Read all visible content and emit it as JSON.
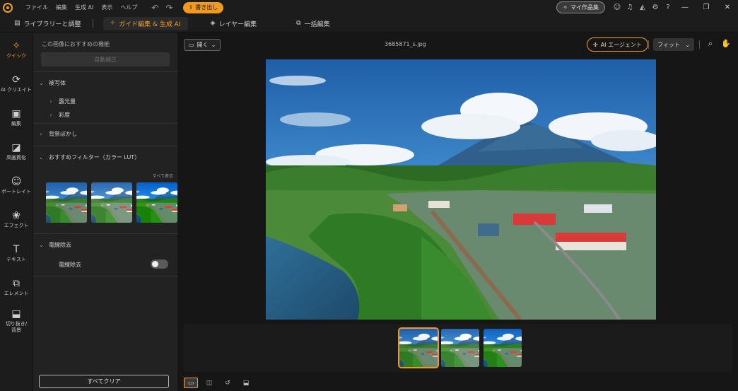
{
  "titlebar": {
    "menu": [
      "ファイル",
      "編集",
      "生成 AI",
      "表示",
      "ヘルプ"
    ],
    "export_label": "書き出し",
    "myworks_label": "マイ作品集"
  },
  "tabs": [
    {
      "label": "ライブラリーと調整",
      "active": false
    },
    {
      "label": "ガイド編集 & 生成 AI",
      "active": true
    },
    {
      "label": "レイヤー編集",
      "active": false
    },
    {
      "label": "一括編集",
      "active": false
    }
  ],
  "rail": [
    {
      "label": "クイック",
      "icon": "magic-wand-icon",
      "glyph": "✧",
      "active": true
    },
    {
      "label": "AI クリエイト",
      "icon": "ai-create-icon",
      "glyph": "⟳",
      "active": false
    },
    {
      "label": "編集",
      "icon": "edit-image-icon",
      "glyph": "▣",
      "active": false
    },
    {
      "label": "高画質化",
      "icon": "enhance-icon",
      "glyph": "◪",
      "active": false
    },
    {
      "label": "ポートレイト",
      "icon": "portrait-icon",
      "glyph": "☺",
      "active": false
    },
    {
      "label": "エフェクト",
      "icon": "effects-icon",
      "glyph": "❀",
      "active": false
    },
    {
      "label": "テキスト",
      "icon": "text-icon",
      "glyph": "T",
      "active": false
    },
    {
      "label": "エレメント",
      "icon": "elements-icon",
      "glyph": "⧉",
      "active": false
    },
    {
      "label": "切り抜き/\n背景",
      "icon": "cutout-icon",
      "glyph": "⬓",
      "active": false
    }
  ],
  "panel": {
    "heading": "この画像におすすめの機能",
    "auto_correct": "自動補正",
    "subject_section": "被写体",
    "exposure": "露光量",
    "saturation": "彩度",
    "bg_blur": "背景ぼかし",
    "filter_section": "おすすめフィルター（カラー LUT）",
    "show_all": "すべて表示",
    "wire_section": "電線除去",
    "wire_toggle_label": "電線除去",
    "clear_all": "すべてクリア"
  },
  "main": {
    "open_label": "開く",
    "filename": "3685871_s.jpg",
    "ai_agent_label": "AI エージェント",
    "fit_label": "フィット"
  },
  "colors": {
    "accent": "#f39a1e",
    "sky": "#2f7fc8",
    "forest": "#2e6a1e"
  }
}
